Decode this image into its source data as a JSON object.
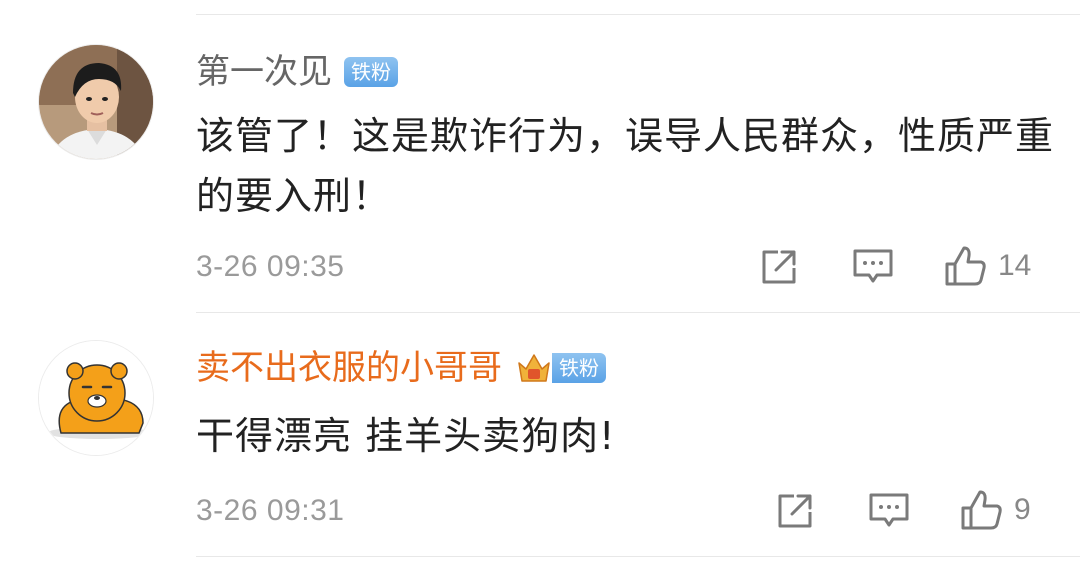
{
  "comments": [
    {
      "username": "第一次见",
      "badge": "铁粉",
      "text": "该管了！这是欺诈行为，误导人民群众，性质严重的要入刑！",
      "time": "3-26 09:35",
      "likes": "14",
      "username_color": "#666666",
      "avatar_icon": "young-man-photo-avatar"
    },
    {
      "username": "卖不出衣服的小哥哥",
      "badge": "铁粉",
      "text": "干得漂亮 挂羊头卖狗肉!",
      "time": "3-26 09:31",
      "likes": "9",
      "username_color": "#e86b1c",
      "avatar_icon": "orange-bear-avatar"
    }
  ],
  "icons": [
    "share-icon",
    "comment-icon",
    "like-icon",
    "crown-icon"
  ]
}
